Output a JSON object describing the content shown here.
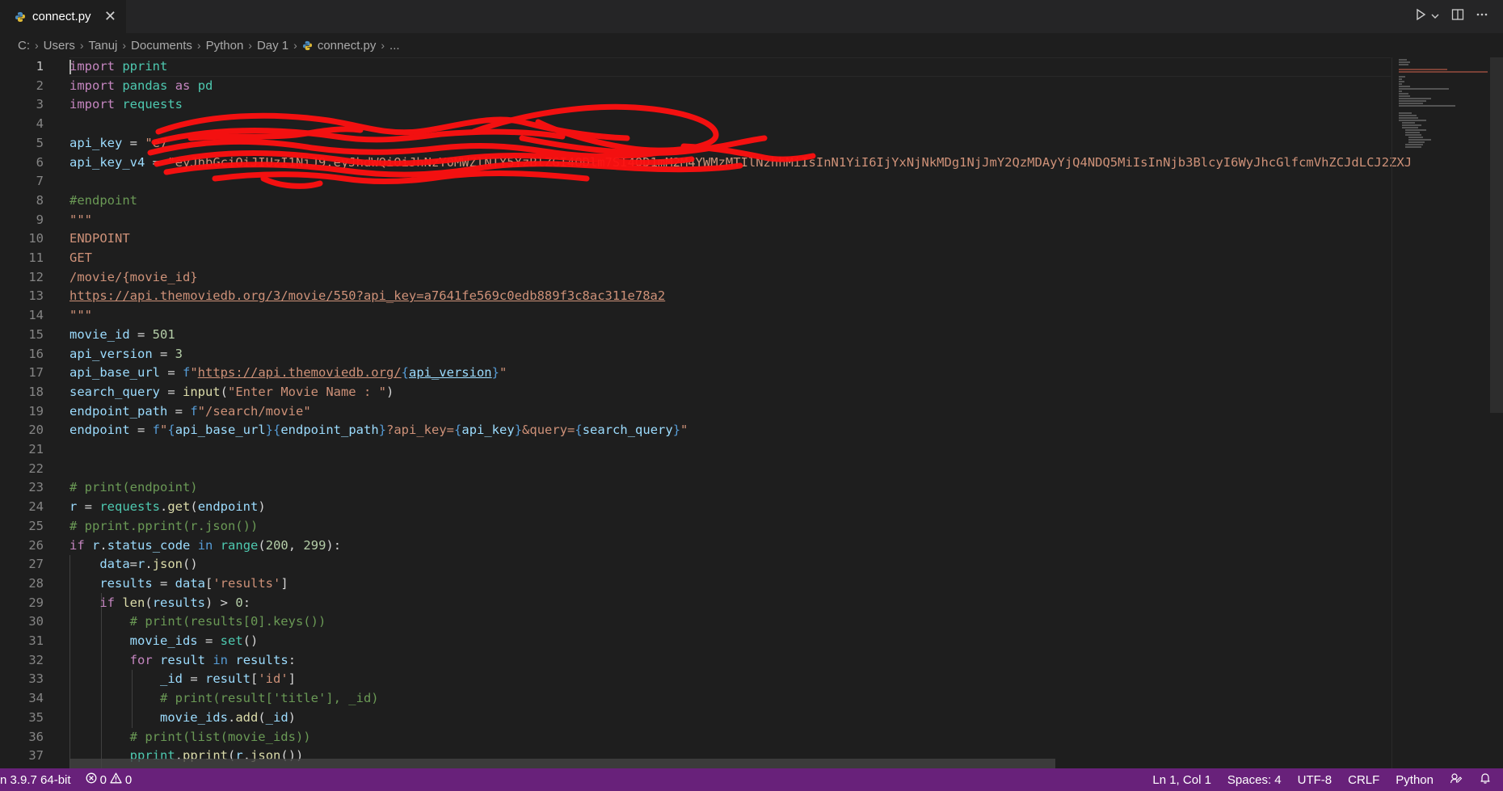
{
  "tab": {
    "filename": "connect.py",
    "close": "✕"
  },
  "breadcrumb": {
    "parts": [
      "C:",
      "Users",
      "Tanuj",
      "Documents",
      "Python",
      "Day 1"
    ],
    "file": "connect.py",
    "more": "..."
  },
  "editor": {
    "line_numbers": [
      "1",
      "2",
      "3",
      "4",
      "5",
      "6",
      "7",
      "8",
      "9",
      "10",
      "11",
      "12",
      "13",
      "14",
      "15",
      "16",
      "17",
      "18",
      "19",
      "20",
      "21",
      "22",
      "23",
      "24",
      "25",
      "26",
      "27",
      "28",
      "29",
      "30",
      "31",
      "32",
      "33",
      "34",
      "35",
      "36",
      "37"
    ],
    "visible_key_tail": "7SI4OD1mM2M4YWMzMTIlNzhhMiIsInN1YiI6IjYxNjNkMDg1NjJmY2QzMDAyYjQ4NDQ5MiIsInNjb3BlcyI6WyJhcGlfcmVhZCJdLCJ2ZXJ"
  },
  "status": {
    "interpreter": "n 3.9.7 64-bit",
    "errors": "0",
    "warnings": "0",
    "position": "Ln 1, Col 1",
    "spaces": "Spaces: 4",
    "encoding": "UTF-8",
    "eol": "CRLF",
    "language": "Python"
  },
  "colors": {
    "statusbar": "#68217a",
    "editor_bg": "#1e1e1e",
    "redaction": "#ff0000"
  }
}
